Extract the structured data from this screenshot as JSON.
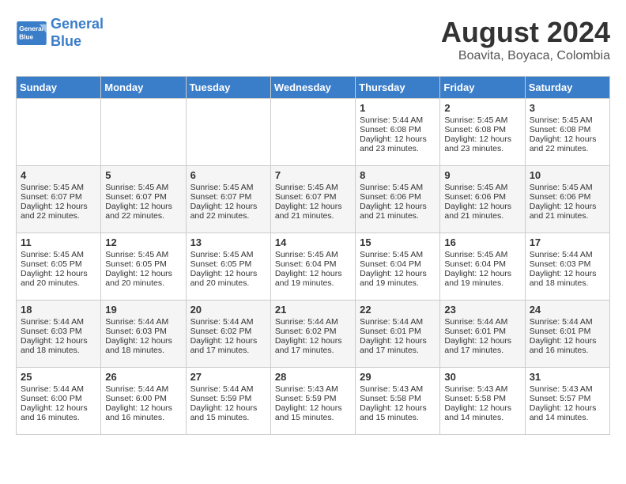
{
  "header": {
    "logo_line1": "General",
    "logo_line2": "Blue",
    "title": "August 2024",
    "subtitle": "Boavita, Boyaca, Colombia"
  },
  "calendar": {
    "days_of_week": [
      "Sunday",
      "Monday",
      "Tuesday",
      "Wednesday",
      "Thursday",
      "Friday",
      "Saturday"
    ],
    "weeks": [
      [
        {
          "day": "",
          "info": ""
        },
        {
          "day": "",
          "info": ""
        },
        {
          "day": "",
          "info": ""
        },
        {
          "day": "",
          "info": ""
        },
        {
          "day": "1",
          "info": "Sunrise: 5:44 AM\nSunset: 6:08 PM\nDaylight: 12 hours\nand 23 minutes."
        },
        {
          "day": "2",
          "info": "Sunrise: 5:45 AM\nSunset: 6:08 PM\nDaylight: 12 hours\nand 23 minutes."
        },
        {
          "day": "3",
          "info": "Sunrise: 5:45 AM\nSunset: 6:08 PM\nDaylight: 12 hours\nand 22 minutes."
        }
      ],
      [
        {
          "day": "4",
          "info": "Sunrise: 5:45 AM\nSunset: 6:07 PM\nDaylight: 12 hours\nand 22 minutes."
        },
        {
          "day": "5",
          "info": "Sunrise: 5:45 AM\nSunset: 6:07 PM\nDaylight: 12 hours\nand 22 minutes."
        },
        {
          "day": "6",
          "info": "Sunrise: 5:45 AM\nSunset: 6:07 PM\nDaylight: 12 hours\nand 22 minutes."
        },
        {
          "day": "7",
          "info": "Sunrise: 5:45 AM\nSunset: 6:07 PM\nDaylight: 12 hours\nand 21 minutes."
        },
        {
          "day": "8",
          "info": "Sunrise: 5:45 AM\nSunset: 6:06 PM\nDaylight: 12 hours\nand 21 minutes."
        },
        {
          "day": "9",
          "info": "Sunrise: 5:45 AM\nSunset: 6:06 PM\nDaylight: 12 hours\nand 21 minutes."
        },
        {
          "day": "10",
          "info": "Sunrise: 5:45 AM\nSunset: 6:06 PM\nDaylight: 12 hours\nand 21 minutes."
        }
      ],
      [
        {
          "day": "11",
          "info": "Sunrise: 5:45 AM\nSunset: 6:05 PM\nDaylight: 12 hours\nand 20 minutes."
        },
        {
          "day": "12",
          "info": "Sunrise: 5:45 AM\nSunset: 6:05 PM\nDaylight: 12 hours\nand 20 minutes."
        },
        {
          "day": "13",
          "info": "Sunrise: 5:45 AM\nSunset: 6:05 PM\nDaylight: 12 hours\nand 20 minutes."
        },
        {
          "day": "14",
          "info": "Sunrise: 5:45 AM\nSunset: 6:04 PM\nDaylight: 12 hours\nand 19 minutes."
        },
        {
          "day": "15",
          "info": "Sunrise: 5:45 AM\nSunset: 6:04 PM\nDaylight: 12 hours\nand 19 minutes."
        },
        {
          "day": "16",
          "info": "Sunrise: 5:45 AM\nSunset: 6:04 PM\nDaylight: 12 hours\nand 19 minutes."
        },
        {
          "day": "17",
          "info": "Sunrise: 5:44 AM\nSunset: 6:03 PM\nDaylight: 12 hours\nand 18 minutes."
        }
      ],
      [
        {
          "day": "18",
          "info": "Sunrise: 5:44 AM\nSunset: 6:03 PM\nDaylight: 12 hours\nand 18 minutes."
        },
        {
          "day": "19",
          "info": "Sunrise: 5:44 AM\nSunset: 6:03 PM\nDaylight: 12 hours\nand 18 minutes."
        },
        {
          "day": "20",
          "info": "Sunrise: 5:44 AM\nSunset: 6:02 PM\nDaylight: 12 hours\nand 17 minutes."
        },
        {
          "day": "21",
          "info": "Sunrise: 5:44 AM\nSunset: 6:02 PM\nDaylight: 12 hours\nand 17 minutes."
        },
        {
          "day": "22",
          "info": "Sunrise: 5:44 AM\nSunset: 6:01 PM\nDaylight: 12 hours\nand 17 minutes."
        },
        {
          "day": "23",
          "info": "Sunrise: 5:44 AM\nSunset: 6:01 PM\nDaylight: 12 hours\nand 17 minutes."
        },
        {
          "day": "24",
          "info": "Sunrise: 5:44 AM\nSunset: 6:01 PM\nDaylight: 12 hours\nand 16 minutes."
        }
      ],
      [
        {
          "day": "25",
          "info": "Sunrise: 5:44 AM\nSunset: 6:00 PM\nDaylight: 12 hours\nand 16 minutes."
        },
        {
          "day": "26",
          "info": "Sunrise: 5:44 AM\nSunset: 6:00 PM\nDaylight: 12 hours\nand 16 minutes."
        },
        {
          "day": "27",
          "info": "Sunrise: 5:44 AM\nSunset: 5:59 PM\nDaylight: 12 hours\nand 15 minutes."
        },
        {
          "day": "28",
          "info": "Sunrise: 5:43 AM\nSunset: 5:59 PM\nDaylight: 12 hours\nand 15 minutes."
        },
        {
          "day": "29",
          "info": "Sunrise: 5:43 AM\nSunset: 5:58 PM\nDaylight: 12 hours\nand 15 minutes."
        },
        {
          "day": "30",
          "info": "Sunrise: 5:43 AM\nSunset: 5:58 PM\nDaylight: 12 hours\nand 14 minutes."
        },
        {
          "day": "31",
          "info": "Sunrise: 5:43 AM\nSunset: 5:57 PM\nDaylight: 12 hours\nand 14 minutes."
        }
      ]
    ]
  }
}
